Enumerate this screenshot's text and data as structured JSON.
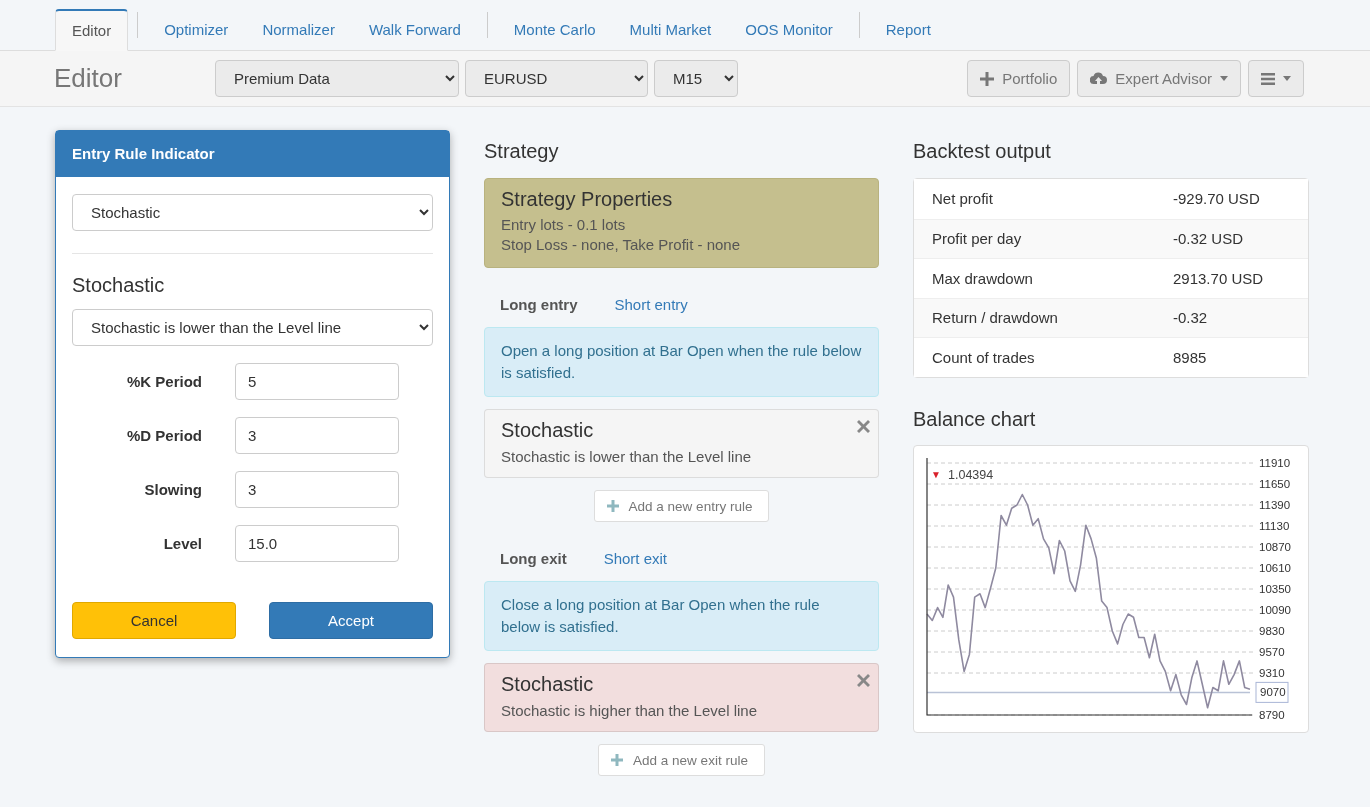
{
  "tab_groups": [
    [
      {
        "label": "Editor",
        "selected": true
      }
    ],
    [
      {
        "label": "Optimizer",
        "selected": false
      },
      {
        "label": "Normalizer",
        "selected": false
      },
      {
        "label": "Walk Forward",
        "selected": false
      }
    ],
    [
      {
        "label": "Monte Carlo",
        "selected": false
      },
      {
        "label": "Multi Market",
        "selected": false
      },
      {
        "label": "OOS Monitor",
        "selected": false
      }
    ],
    [
      {
        "label": "Report",
        "selected": false
      }
    ]
  ],
  "toolbar": {
    "title": "Editor",
    "selects": [
      {
        "value": "Premium Data"
      },
      {
        "value": "EURUSD"
      },
      {
        "value": "M15"
      }
    ],
    "buttons": [
      {
        "kind": "plus",
        "label": "Portfolio",
        "caret": false
      },
      {
        "kind": "cloud",
        "label": "Expert Advisor",
        "caret": true
      },
      {
        "kind": "menu",
        "caret": true
      }
    ]
  },
  "indicator_dialog": {
    "title": "Entry Rule Indicator",
    "indicator": "Stochastic",
    "heading": "Stochastic",
    "rule": "Stochastic is lower than the Level line",
    "params": [
      {
        "label": "%K Period",
        "value": "5"
      },
      {
        "label": "%D Period",
        "value": "3"
      },
      {
        "label": "Slowing",
        "value": "3"
      },
      {
        "label": "Level",
        "value": "15.0"
      }
    ],
    "buttons": [
      {
        "kind": "warning",
        "label": "Cancel"
      },
      {
        "kind": "primary",
        "label": "Accept"
      }
    ]
  },
  "strategy": {
    "heading": "Strategy",
    "properties": {
      "title": "Strategy Properties",
      "lines": [
        "Entry lots - 0.1 lots",
        "Stop Loss - none, Take Profit - none"
      ]
    },
    "sections": [
      {
        "tabs": [
          {
            "label": "Long entry",
            "selected": true
          },
          {
            "label": "Short entry",
            "selected": false
          }
        ],
        "info": "Open a long position at Bar Open when the rule below is satisfied.",
        "rules": [
          {
            "color": "#f5f5f5",
            "title": "Stochastic",
            "text": "Stochastic is lower than the Level line"
          }
        ],
        "add_button": "Add a new entry rule"
      },
      {
        "tabs": [
          {
            "label": "Long exit",
            "selected": true
          },
          {
            "label": "Short exit",
            "selected": false
          }
        ],
        "info": "Close a long position at Bar Open when the rule below is satisfied.",
        "rules": [
          {
            "color": "#f2dede",
            "title": "Stochastic",
            "text": "Stochastic is higher than the Level line"
          }
        ],
        "add_button": "Add a new exit rule"
      }
    ]
  },
  "backtest": {
    "heading": "Backtest output",
    "rows": [
      {
        "label": "Net profit",
        "value": "-929.70 USD"
      },
      {
        "label": "Profit per day",
        "value": "-0.32 USD"
      },
      {
        "label": "Max drawdown",
        "value": "2913.70 USD"
      },
      {
        "label": "Return / drawdown",
        "value": "-0.32"
      },
      {
        "label": "Count of trades",
        "value": "8985"
      }
    ]
  },
  "balance": {
    "heading": "Balance chart",
    "price_label": {
      "arrow": "▼",
      "text": "1.04394"
    },
    "chart_data": {
      "type": "line",
      "grid": true,
      "ylim": [
        8790,
        11910
      ],
      "yticks": [
        8790,
        9070,
        9310,
        9570,
        9830,
        10090,
        10350,
        10610,
        10870,
        11130,
        11390,
        11650,
        11910
      ],
      "series": [
        {
          "color": "#8f8aa0",
          "values": [
            10040,
            9960,
            10120,
            10000,
            10400,
            10250,
            9720,
            9330,
            9540,
            10250,
            10290,
            10120,
            10360,
            10610,
            11260,
            11140,
            11350,
            11390,
            11520,
            11390,
            11140,
            11220,
            10970,
            10860,
            10540,
            10950,
            10820,
            10450,
            10320,
            10650,
            11140,
            10970,
            10730,
            10200,
            10120,
            9830,
            9670,
            9910,
            10040,
            10000,
            9750,
            9750,
            9500,
            9790,
            9460,
            9330,
            9090,
            9290,
            9040,
            8920,
            9250,
            9460,
            9170,
            8880,
            9130,
            9090,
            9460,
            9170,
            9290,
            9460,
            9130,
            9110
          ]
        },
        {
          "color": "#b9c2d6",
          "values": [
            9070,
            9070,
            9070,
            9070,
            9070,
            9070,
            9070,
            9070,
            9070,
            9070,
            9070,
            9070,
            9070,
            9070,
            9070,
            9070,
            9070,
            9070,
            9070,
            9070,
            9070,
            9070,
            9070,
            9070,
            9070,
            9070,
            9070,
            9070,
            9070,
            9070,
            9070,
            9070,
            9070,
            9070,
            9070,
            9070,
            9070,
            9070,
            9070,
            9070,
            9070,
            9070,
            9070,
            9070,
            9070,
            9070,
            9070,
            9070,
            9070,
            9070,
            9070,
            9070,
            9070,
            9070,
            9070,
            9070,
            9070,
            9070,
            9070,
            9070,
            9070,
            9070
          ]
        }
      ]
    }
  }
}
